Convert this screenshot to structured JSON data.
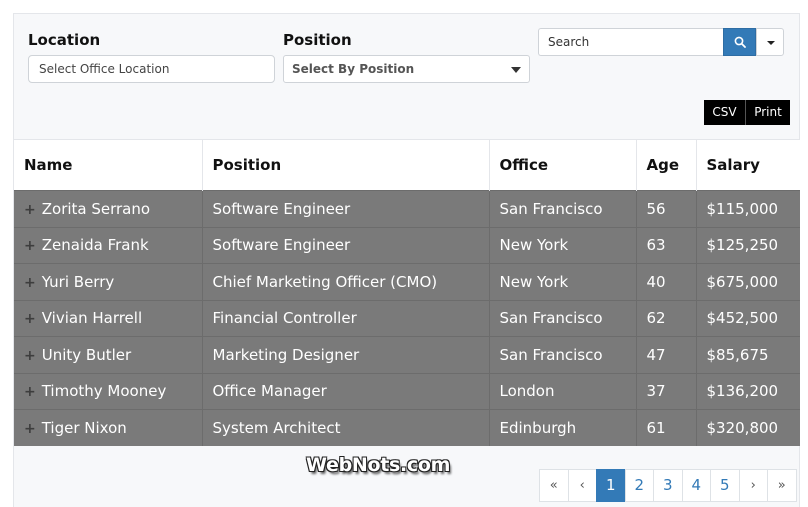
{
  "filters": {
    "location_label": "Location",
    "location_placeholder": "Select Office Location",
    "position_label": "Position",
    "position_selected": "Select By Position"
  },
  "search": {
    "placeholder": "Search"
  },
  "export": {
    "csv_label": "CSV",
    "print_label": "Print"
  },
  "table": {
    "headers": [
      "Name",
      "Position",
      "Office",
      "Age",
      "Salary"
    ],
    "rows": [
      {
        "expander": "+",
        "name": "Zorita Serrano",
        "position": "Software Engineer",
        "office": "San Francisco",
        "age": "56",
        "salary": "$115,000"
      },
      {
        "expander": "+",
        "name": "Zenaida Frank",
        "position": "Software Engineer",
        "office": "New York",
        "age": "63",
        "salary": "$125,250"
      },
      {
        "expander": "+",
        "name": "Yuri Berry",
        "position": "Chief Marketing Officer (CMO)",
        "office": "New York",
        "age": "40",
        "salary": "$675,000"
      },
      {
        "expander": "+",
        "name": "Vivian Harrell",
        "position": "Financial Controller",
        "office": "San Francisco",
        "age": "62",
        "salary": "$452,500"
      },
      {
        "expander": "+",
        "name": "Unity Butler",
        "position": "Marketing Designer",
        "office": "San Francisco",
        "age": "47",
        "salary": "$85,675"
      },
      {
        "expander": "+",
        "name": "Timothy Mooney",
        "position": "Office Manager",
        "office": "London",
        "age": "37",
        "salary": "$136,200"
      },
      {
        "expander": "+",
        "name": "Tiger Nixon",
        "position": "System Architect",
        "office": "Edinburgh",
        "age": "61",
        "salary": "$320,800"
      }
    ]
  },
  "watermark": "WebNots.com",
  "pagination": {
    "first": "«",
    "prev": "‹",
    "pages": [
      "1",
      "2",
      "3",
      "4",
      "5"
    ],
    "active_page": "1",
    "next": "›",
    "last": "»"
  },
  "colors": {
    "accent": "#337ab7",
    "row_background": "#7a7a7a",
    "export_button": "#000000"
  },
  "icons": {
    "search_button": "search-icon",
    "dropdown": "chevron-down-icon",
    "row_expand": "plus-icon"
  }
}
